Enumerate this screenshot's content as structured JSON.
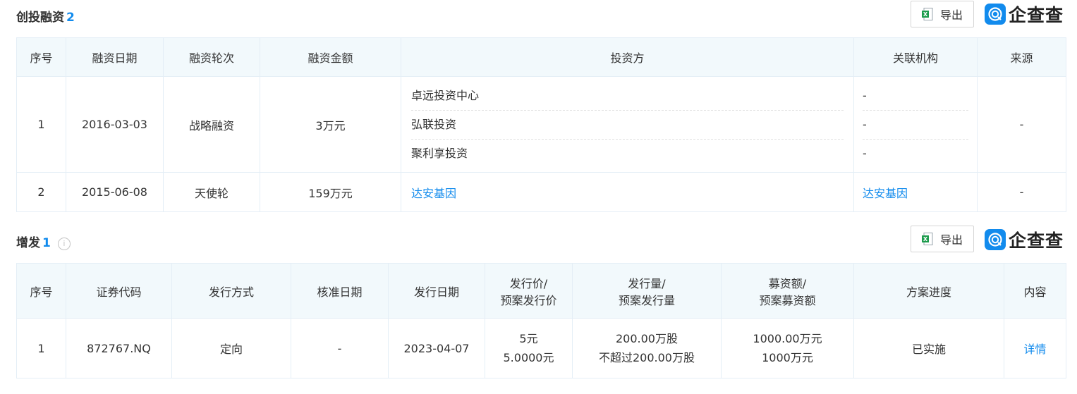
{
  "section1": {
    "title": "创投融资",
    "count": "2",
    "export_label": "导出",
    "logo_text": "企查查",
    "headers": [
      "序号",
      "融资日期",
      "融资轮次",
      "融资金额",
      "投资方",
      "关联机构",
      "来源"
    ],
    "rows": [
      {
        "index": "1",
        "date": "2016-03-03",
        "round": "战略融资",
        "amount": "3万元",
        "investors": [
          "卓远投资中心",
          "弘联投资",
          "聚利享投资"
        ],
        "related": [
          "-",
          "-",
          "-"
        ],
        "source": "-"
      },
      {
        "index": "2",
        "date": "2015-06-08",
        "round": "天使轮",
        "amount": "159万元",
        "investor": "达安基因",
        "related": "达安基因",
        "source": "-"
      }
    ]
  },
  "section2": {
    "title": "增发",
    "count": "1",
    "info_icon": "i",
    "export_label": "导出",
    "logo_text": "企查查",
    "headers": {
      "index": "序号",
      "code": "证券代码",
      "method": "发行方式",
      "approve_date": "核准日期",
      "issue_date": "发行日期",
      "price_1": "发行价/",
      "price_2": "预案发行价",
      "volume_1": "发行量/",
      "volume_2": "预案发行量",
      "funds_1": "募资额/",
      "funds_2": "预案募资额",
      "progress": "方案进度",
      "content": "内容"
    },
    "rows": [
      {
        "index": "1",
        "code": "872767.NQ",
        "method": "定向",
        "approve_date": "-",
        "issue_date": "2023-04-07",
        "price": "5元",
        "plan_price": "5.0000元",
        "volume": "200.00万股",
        "plan_volume": "不超过200.00万股",
        "funds": "1000.00万元",
        "plan_funds": "1000万元",
        "progress": "已实施",
        "content": "详情"
      }
    ]
  },
  "colors": {
    "accent": "#128bed",
    "header_bg": "#f2f9fc",
    "border": "#e4eef6",
    "excel_green": "#1d9c4d"
  }
}
